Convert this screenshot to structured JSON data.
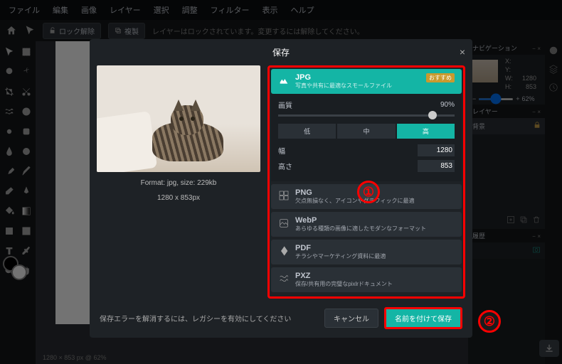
{
  "menu": [
    "ファイル",
    "編集",
    "画像",
    "レイヤー",
    "選択",
    "調整",
    "フィルター",
    "表示",
    "ヘルプ"
  ],
  "toolbar": {
    "unlock": "ロック解除",
    "duplicate": "複製",
    "lock_msg": "レイヤーはロックされています。変更するには解除してください。"
  },
  "right": {
    "nav_title": "ナビゲーション",
    "x_label": "X:",
    "y_label": "Y:",
    "w_label": "W:",
    "h_label": "H:",
    "w_val": "1280",
    "h_val": "853",
    "zoom_minus": "−",
    "zoom_plus": "+",
    "zoom": "62%",
    "layers_title": "レイヤー",
    "layer_bg": "背景",
    "history_title": "履歴"
  },
  "status": "1280 × 853 px @ 62%",
  "modal": {
    "title": "保存",
    "close": "×",
    "format_line": "Format: jpg, size: 229kb",
    "dims_line": "1280 x 853px",
    "formats": {
      "jpg": {
        "name": "JPG",
        "desc": "写真や共有に最適なスモールファイル",
        "badge": "おすすめ"
      },
      "png": {
        "name": "PNG",
        "desc": "欠点無損なく、アイコンやグラフィックに最適"
      },
      "webp": {
        "name": "WebP",
        "desc": "あらゆる種類の画像に適したモダンなフォーマット"
      },
      "pdf": {
        "name": "PDF",
        "desc": "チラシやマーケティング資料に最適"
      },
      "pxz": {
        "name": "PXZ",
        "desc": "保存/共有用の完璧なpixlrドキュメント"
      }
    },
    "quality_label": "画質",
    "quality_value": "90%",
    "q_low": "低",
    "q_mid": "中",
    "q_high": "高",
    "width_label": "幅",
    "width_val": "1280",
    "height_label": "高さ",
    "height_val": "853",
    "legacy": "保存エラーを解消するには、レガシーを有効にしてください",
    "cancel": "キャンセル",
    "save": "名前を付けて保存"
  },
  "anno": {
    "n1": "①",
    "n2": "②"
  }
}
